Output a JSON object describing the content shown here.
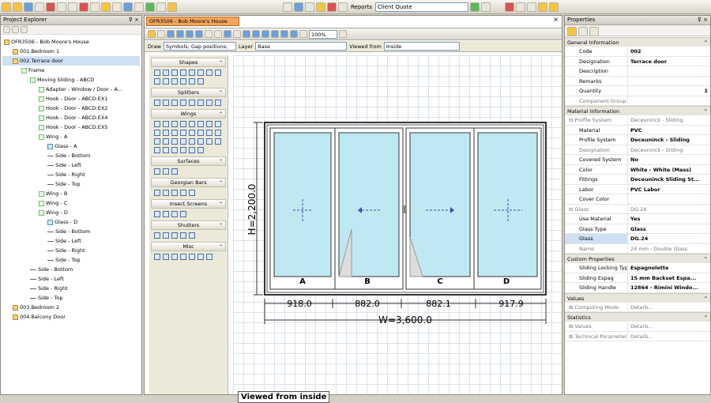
{
  "toolbar": {
    "reports_label": "Reports",
    "report_select_value": "Client Quote"
  },
  "project_explorer": {
    "title": "Project Explorer",
    "pin_close": "⊽ ×",
    "tree": [
      {
        "label": "OFR3506 - Bob Moore's House",
        "indent": 0,
        "icon": "folder"
      },
      {
        "label": "001.Bedroom 1",
        "indent": 1,
        "icon": "folder"
      },
      {
        "label": "002.Terrace door",
        "indent": 1,
        "icon": "folder",
        "selected": true
      },
      {
        "label": "Frame",
        "indent": 2,
        "icon": "frame"
      },
      {
        "label": "Moving Sliding - ABCD",
        "indent": 3,
        "icon": "frame"
      },
      {
        "label": "Adapter - Window / Door - A...",
        "indent": 4,
        "icon": "frame"
      },
      {
        "label": "Hook - Door - ABCD:EX1",
        "indent": 4,
        "icon": "frame"
      },
      {
        "label": "Hook - Door - ABCD:EX2",
        "indent": 4,
        "icon": "frame"
      },
      {
        "label": "Hook - Door - ABCD:EX4",
        "indent": 4,
        "icon": "frame"
      },
      {
        "label": "Hook - Door - ABCD:EX5",
        "indent": 4,
        "icon": "frame"
      },
      {
        "label": "Wing - A",
        "indent": 4,
        "icon": "frame"
      },
      {
        "label": "Glass - A",
        "indent": 5,
        "icon": "glass"
      },
      {
        "label": "Side - Bottom",
        "indent": 5,
        "icon": "line"
      },
      {
        "label": "Side - Left",
        "indent": 5,
        "icon": "line"
      },
      {
        "label": "Side - Right",
        "indent": 5,
        "icon": "line"
      },
      {
        "label": "Side - Top",
        "indent": 5,
        "icon": "line"
      },
      {
        "label": "Wing - B",
        "indent": 4,
        "icon": "frame"
      },
      {
        "label": "Wing - C",
        "indent": 4,
        "icon": "frame"
      },
      {
        "label": "Wing - D",
        "indent": 4,
        "icon": "frame"
      },
      {
        "label": "Glass - D",
        "indent": 5,
        "icon": "glass"
      },
      {
        "label": "Side - Bottom",
        "indent": 5,
        "icon": "line"
      },
      {
        "label": "Side - Left",
        "indent": 5,
        "icon": "line"
      },
      {
        "label": "Side - Right",
        "indent": 5,
        "icon": "line"
      },
      {
        "label": "Side - Top",
        "indent": 5,
        "icon": "line"
      },
      {
        "label": "Side - Bottom",
        "indent": 3,
        "icon": "line"
      },
      {
        "label": "Side - Left",
        "indent": 3,
        "icon": "line"
      },
      {
        "label": "Side - Right",
        "indent": 3,
        "icon": "line"
      },
      {
        "label": "Side - Top",
        "indent": 3,
        "icon": "line"
      },
      {
        "label": "003.Bedroom 2",
        "indent": 1,
        "icon": "folder"
      },
      {
        "label": "004.Balcony Door",
        "indent": 1,
        "icon": "folder"
      }
    ]
  },
  "document": {
    "tab_label": "OFR3506 - Bob Moore's House",
    "close": "×",
    "zoom_value": "100%",
    "draw_label": "Draw",
    "draw_value": "Symbols; Gap positions; ...",
    "layer_label": "Layer",
    "layer_value": "Base",
    "viewed_from_label": "Viewed from",
    "viewed_from_value": "Inside",
    "viewed_banner": "Viewed from inside"
  },
  "palette": {
    "sections": [
      {
        "title": "Shapes",
        "count": 14
      },
      {
        "title": "Splitters",
        "count": 8
      },
      {
        "title": "Wings",
        "count": 30
      },
      {
        "title": "Surfaces",
        "count": 3
      },
      {
        "title": "Georgian Bars",
        "count": 5
      },
      {
        "title": "Insect Screens",
        "count": 4
      },
      {
        "title": "Shutters",
        "count": 5
      },
      {
        "title": "Misc",
        "count": 7
      }
    ]
  },
  "drawing": {
    "height_label": "H=2,200.0",
    "width_label": "W=3,600.0",
    "panels": [
      "A",
      "B",
      "C",
      "D"
    ],
    "widths": [
      "918.0",
      "882.0",
      "882.1",
      "917.9"
    ]
  },
  "properties": {
    "title": "Properties",
    "pin_close": "⊽ ×",
    "sections": [
      {
        "title": "General Information",
        "rows": [
          {
            "k": "Code",
            "v": "002",
            "style": "bold"
          },
          {
            "k": "Designation",
            "v": "Terrace door",
            "style": "bold"
          },
          {
            "k": "Description",
            "v": ""
          },
          {
            "k": "Remarks",
            "v": ""
          },
          {
            "k": "Quantity",
            "v": "1",
            "style": "bold right"
          },
          {
            "k": "Component Group",
            "v": "",
            "style": "grey"
          }
        ]
      },
      {
        "title": "Material Information",
        "rows": [
          {
            "k": "⊟ Profile System",
            "v": "Deceuninck - Sliding",
            "style": "grey sub"
          },
          {
            "k": "Material",
            "v": "PVC",
            "style": "bold"
          },
          {
            "k": "Profile System",
            "v": "Deceuninck - Sliding",
            "style": "bold"
          },
          {
            "k": "Designation",
            "v": "Deceuninck - Sliding",
            "style": "grey"
          },
          {
            "k": "Covered System",
            "v": "No",
            "style": "bold"
          },
          {
            "k": "Color",
            "v": "White - White (Mass)",
            "style": "bold"
          },
          {
            "k": "Fittings",
            "v": "Deceuninck Sliding St...",
            "style": "bold"
          },
          {
            "k": "Labor",
            "v": "PVC Labor",
            "style": "bold"
          },
          {
            "k": "Cover Color",
            "v": ""
          },
          {
            "k": "⊟ Glass",
            "v": "DG.24",
            "style": "grey sub"
          },
          {
            "k": "Use Material",
            "v": "Yes",
            "style": "bold"
          },
          {
            "k": "Glass Type",
            "v": "Glass",
            "style": "bold"
          },
          {
            "k": "Glass",
            "v": "DG.24",
            "style": "bold selr"
          },
          {
            "k": "Name",
            "v": "24 mm - Double Glass",
            "style": "grey"
          }
        ]
      },
      {
        "title": "Custom Properties",
        "rows": [
          {
            "k": "Sliding Locking Type",
            "v": "Espagnolette",
            "style": "bold"
          },
          {
            "k": "Sliding Espag",
            "v": "15 mm Backset Espa...",
            "style": "bold"
          },
          {
            "k": "Sliding Handle",
            "v": "12864 - Rimini Windo...",
            "style": "bold"
          }
        ]
      },
      {
        "title": "Values",
        "rows": [
          {
            "k": "⊞ Computing Mode",
            "v": "Details...",
            "style": "grey sub"
          }
        ]
      },
      {
        "title": "Statistics",
        "rows": [
          {
            "k": "⊞ Values",
            "v": "Details...",
            "style": "grey sub"
          },
          {
            "k": "⊞ Technical Parameters",
            "v": "Details...",
            "style": "grey sub"
          }
        ]
      }
    ]
  }
}
